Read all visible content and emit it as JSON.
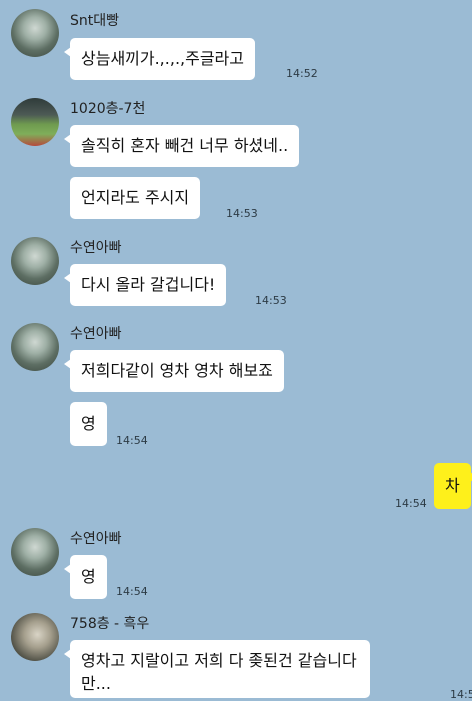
{
  "messages": [
    {
      "sender": "Snt대빵",
      "text": "상늠새끼가.,.,.,주글라고",
      "time": "14:52"
    },
    {
      "sender": "1020층-7천",
      "text": "솔직히 혼자 빼건 너무 하셨네..",
      "time": ""
    },
    {
      "sender": "",
      "text": "언지라도 주시지",
      "time": "14:53"
    },
    {
      "sender": "수연아빠",
      "text": "다시 올라 갈겁니다!",
      "time": "14:53"
    },
    {
      "sender": "수연아빠",
      "text": "저희다같이 영차 영차 해보죠",
      "time": ""
    },
    {
      "sender": "",
      "text": "영",
      "time": "14:54"
    },
    {
      "sender": "me",
      "text": "차",
      "time": "14:54"
    },
    {
      "sender": "수연아빠",
      "text": "영",
      "time": "14:54"
    },
    {
      "sender": "758층 - 흑우",
      "text": "영차고 지랄이고 저희 다 좆된건 같습니다만...",
      "time": "14:5"
    }
  ]
}
